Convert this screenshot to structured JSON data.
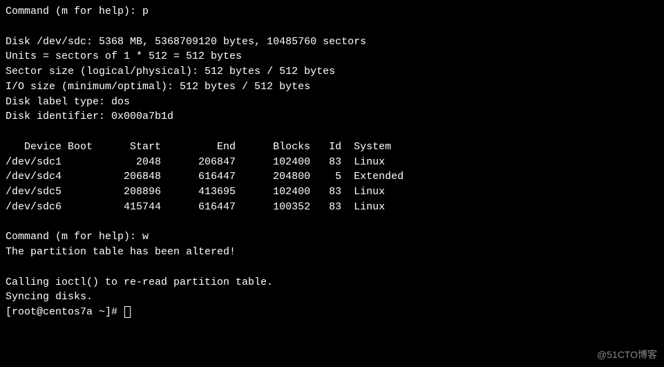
{
  "cmd1": {
    "prompt": "Command (m for help): ",
    "input": "p"
  },
  "disk_info": {
    "line1": "Disk /dev/sdc: 5368 MB, 5368709120 bytes, 10485760 sectors",
    "line2": "Units = sectors of 1 * 512 = 512 bytes",
    "line3": "Sector size (logical/physical): 512 bytes / 512 bytes",
    "line4": "I/O size (minimum/optimal): 512 bytes / 512 bytes",
    "line5": "Disk label type: dos",
    "line6": "Disk identifier: 0x000a7b1d"
  },
  "table": {
    "header": "   Device Boot      Start         End      Blocks   Id  System",
    "rows": [
      "/dev/sdc1            2048      206847      102400   83  Linux",
      "/dev/sdc4          206848      616447      204800    5  Extended",
      "/dev/sdc5          208896      413695      102400   83  Linux",
      "/dev/sdc6          415744      616447      100352   83  Linux"
    ]
  },
  "cmd2": {
    "prompt": "Command (m for help): ",
    "input": "w"
  },
  "output": {
    "line1": "The partition table has been altered!",
    "line2": "Calling ioctl() to re-read partition table.",
    "line3": "Syncing disks."
  },
  "shell_prompt": "[root@centos7a ~]# ",
  "watermark": "@51CTO博客",
  "chart_data": {
    "type": "table",
    "title": "fdisk partition table for /dev/sdc",
    "columns": [
      "Device",
      "Boot",
      "Start",
      "End",
      "Blocks",
      "Id",
      "System"
    ],
    "rows": [
      {
        "Device": "/dev/sdc1",
        "Boot": "",
        "Start": 2048,
        "End": 206847,
        "Blocks": 102400,
        "Id": "83",
        "System": "Linux"
      },
      {
        "Device": "/dev/sdc4",
        "Boot": "",
        "Start": 206848,
        "End": 616447,
        "Blocks": 204800,
        "Id": "5",
        "System": "Extended"
      },
      {
        "Device": "/dev/sdc5",
        "Boot": "",
        "Start": 208896,
        "End": 413695,
        "Blocks": 102400,
        "Id": "83",
        "System": "Linux"
      },
      {
        "Device": "/dev/sdc6",
        "Boot": "",
        "Start": 415744,
        "End": 616447,
        "Blocks": 100352,
        "Id": "83",
        "System": "Linux"
      }
    ],
    "disk": {
      "path": "/dev/sdc",
      "size_mb": 5368,
      "size_bytes": 5368709120,
      "sectors": 10485760,
      "unit_bytes": 512,
      "sector_size_logical": 512,
      "sector_size_physical": 512,
      "io_size_min": 512,
      "io_size_optimal": 512,
      "label_type": "dos",
      "identifier": "0x000a7b1d"
    }
  }
}
